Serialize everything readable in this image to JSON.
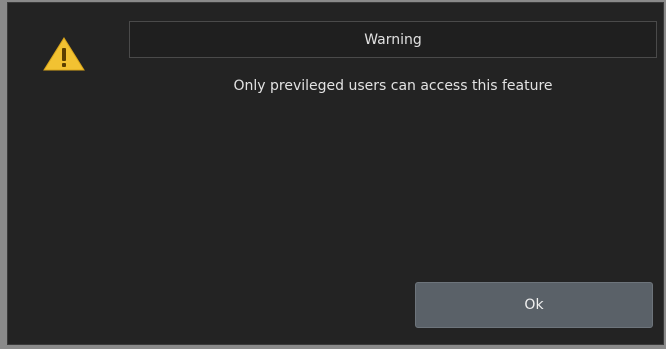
{
  "dialog": {
    "title": "Warning",
    "message": "Only previleged users can access this feature",
    "ok_label": "Ok",
    "icon": "warning-triangle-icon",
    "colors": {
      "background": "#232323",
      "button": "#5a6168",
      "warning": "#f2c232"
    }
  }
}
